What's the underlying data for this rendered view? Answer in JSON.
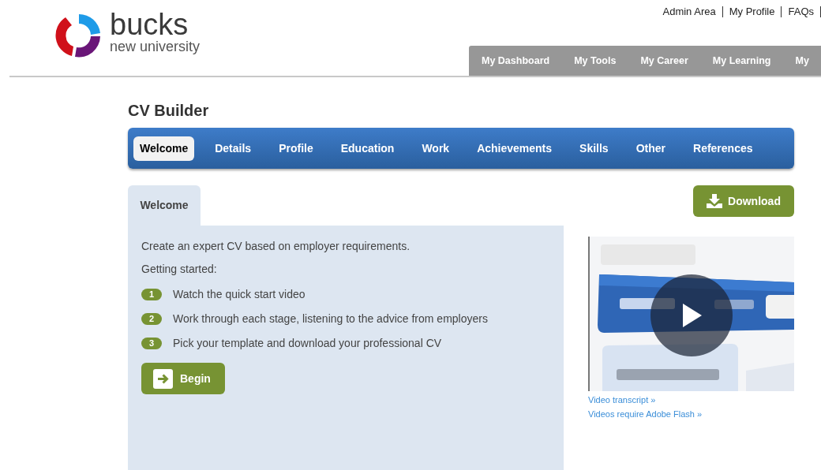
{
  "logo": {
    "name": "bucks",
    "tagline": "new university"
  },
  "top_links": [
    "Admin Area",
    "My Profile",
    "FAQs"
  ],
  "main_nav": [
    {
      "label": "My Dashboard"
    },
    {
      "label": "My Tools"
    },
    {
      "label": "My Career"
    },
    {
      "label": "My Learning"
    },
    {
      "label": "My"
    }
  ],
  "page_title": "CV Builder",
  "cv_tabs": [
    {
      "label": "Welcome",
      "selected": true
    },
    {
      "label": "Details",
      "selected": false
    },
    {
      "label": "Profile",
      "selected": false
    },
    {
      "label": "Education",
      "selected": false
    },
    {
      "label": "Work",
      "selected": false
    },
    {
      "label": "Achievements",
      "selected": false
    },
    {
      "label": "Skills",
      "selected": false
    },
    {
      "label": "Other",
      "selected": false
    },
    {
      "label": "References",
      "selected": false
    }
  ],
  "panel": {
    "tab": "Welcome",
    "intro": "Create an expert CV based on employer requirements.",
    "subheading": "Getting started:",
    "steps": [
      {
        "number": "1",
        "text": "Watch the quick start video"
      },
      {
        "number": "2",
        "text": "Work through each stage, listening to the advice from employers"
      },
      {
        "number": "3",
        "text": "Pick your template and download your professional CV"
      }
    ],
    "begin_button": "Begin"
  },
  "download_button": "Download",
  "video": {
    "kind": "picture",
    "links": [
      "Video transcript »",
      "Videos require Adobe Flash »"
    ]
  }
}
